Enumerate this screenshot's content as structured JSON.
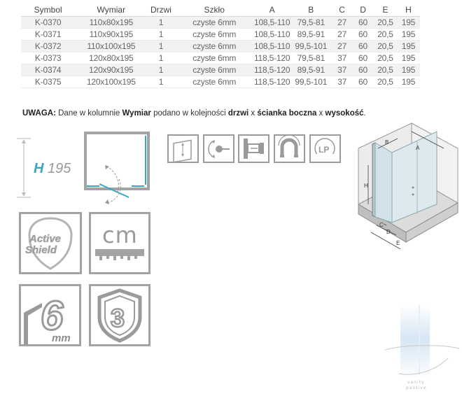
{
  "table": {
    "headers": [
      "Symbol",
      "Wymiar",
      "Drzwi",
      "Szkło",
      "A",
      "B",
      "C",
      "D",
      "E",
      "H"
    ],
    "rows": [
      [
        "K-0370",
        "110x80x195",
        "1",
        "czyste 6mm",
        "108,5-110",
        "79,5-81",
        "27",
        "60",
        "20,5",
        "195"
      ],
      [
        "K-0371",
        "110x90x195",
        "1",
        "czyste 6mm",
        "108,5-110",
        "89,5-91",
        "27",
        "60",
        "20,5",
        "195"
      ],
      [
        "K-0372",
        "110x100x195",
        "1",
        "czyste 6mm",
        "108,5-110",
        "99,5-101",
        "27",
        "60",
        "20,5",
        "195"
      ],
      [
        "K-0373",
        "120x80x195",
        "1",
        "czyste 6mm",
        "118,5-120",
        "79,5-81",
        "37",
        "60",
        "20,5",
        "195"
      ],
      [
        "K-0374",
        "120x90x195",
        "1",
        "czyste 6mm",
        "118,5-120",
        "89,5-91",
        "37",
        "60",
        "20,5",
        "195"
      ],
      [
        "K-0375",
        "120x100x195",
        "1",
        "czyste 6mm",
        "118,5-120",
        "99,5-101",
        "37",
        "60",
        "20,5",
        "195"
      ]
    ]
  },
  "note": {
    "prefix": "UWAGA:",
    "t1": " Dane w kolumnie ",
    "b1": "Wymiar",
    "t2": " podano w kolejności ",
    "b2": "drzwi",
    "t3": " x ",
    "b3": "ścianka boczna",
    "t4": " x ",
    "b4": "wysokość",
    "t5": "."
  },
  "height": {
    "letter": "H",
    "value": "195"
  },
  "icons": {
    "active_shield_line1": "Active",
    "active_shield_line2": "Shield",
    "cm": "cm",
    "glass_thickness": "6",
    "glass_unit": "mm",
    "warranty": "3",
    "lp": "LP"
  },
  "diagram_labels": {
    "a": "A",
    "b": "B",
    "c": "C",
    "d": "D",
    "e": "E",
    "h": "H"
  },
  "watermark": {
    "text": "vanity\npassive"
  },
  "colors": {
    "accent": "#3aa6c1",
    "icon_gray": "#9a9a9a",
    "row_stripe": "#f2f2f2"
  }
}
